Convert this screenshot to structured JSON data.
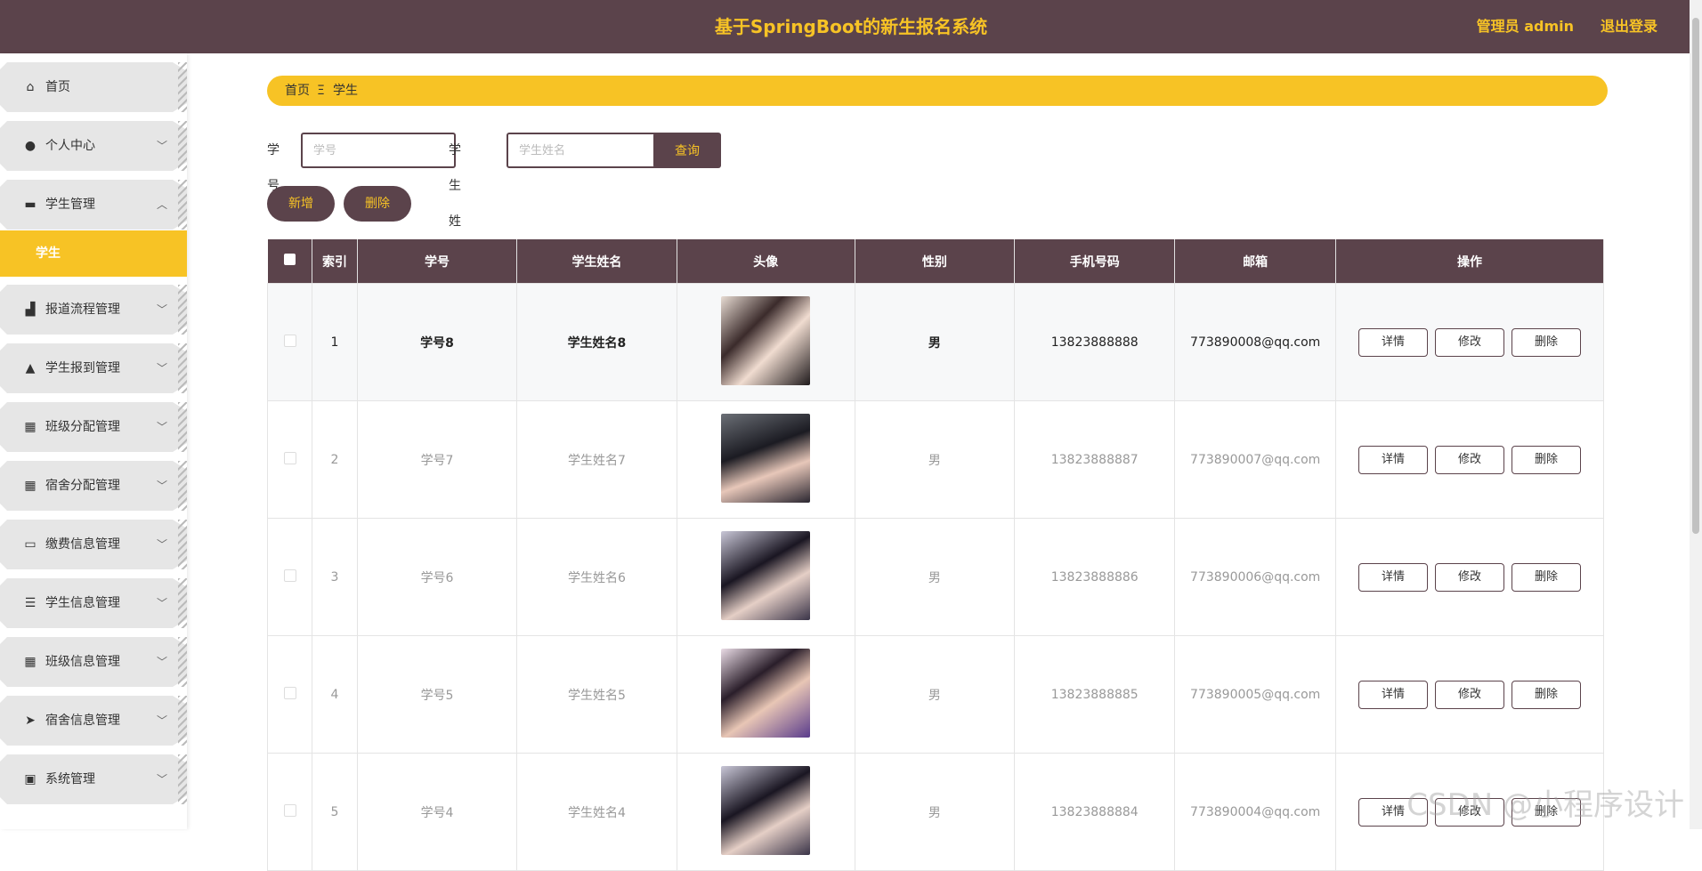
{
  "header": {
    "title": "基于SpringBoot的新生报名系统",
    "user": "管理员 admin",
    "logout": "退出登录"
  },
  "sidebar": {
    "items": [
      {
        "label": "首页",
        "icon": "home-icon",
        "glyph": "⌂",
        "chevron": ""
      },
      {
        "label": "个人中心",
        "icon": "user-icon",
        "glyph": "●",
        "chevron": "﹀"
      },
      {
        "label": "学生管理",
        "icon": "flag-icon",
        "glyph": "▬",
        "chevron": "︿"
      },
      {
        "label": "报道流程管理",
        "icon": "building-icon",
        "glyph": "▟",
        "chevron": "﹀"
      },
      {
        "label": "学生报到管理",
        "icon": "person-icon",
        "glyph": "▲",
        "chevron": "﹀"
      },
      {
        "label": "班级分配管理",
        "icon": "grid-icon",
        "glyph": "▦",
        "chevron": "﹀"
      },
      {
        "label": "宿舍分配管理",
        "icon": "grid-icon",
        "glyph": "▦",
        "chevron": "﹀"
      },
      {
        "label": "缴费信息管理",
        "icon": "monitor-icon",
        "glyph": "▭",
        "chevron": "﹀"
      },
      {
        "label": "学生信息管理",
        "icon": "list-icon",
        "glyph": "☰",
        "chevron": "﹀"
      },
      {
        "label": "班级信息管理",
        "icon": "grid-icon",
        "glyph": "▦",
        "chevron": "﹀"
      },
      {
        "label": "宿舍信息管理",
        "icon": "send-icon",
        "glyph": "➤",
        "chevron": "﹀"
      },
      {
        "label": "系统管理",
        "icon": "clipboard-icon",
        "glyph": "▣",
        "chevron": "﹀"
      }
    ],
    "sub_item": "学生"
  },
  "breadcrumb": {
    "home": "首页",
    "sep": "Ξ",
    "current": "学生"
  },
  "search": {
    "id_label": "学号",
    "id_placeholder": "学号",
    "name_label": "学生姓名",
    "name_placeholder": "学生姓名",
    "query": "查询"
  },
  "actions": {
    "add": "新增",
    "delete": "删除"
  },
  "table": {
    "headers": [
      "索引",
      "学号",
      "学生姓名",
      "头像",
      "性别",
      "手机号码",
      "邮箱",
      "操作"
    ],
    "row_actions": [
      "详情",
      "修改",
      "删除"
    ],
    "rows": [
      {
        "index": "1",
        "id": "学号8",
        "name": "学生姓名8",
        "gender": "男",
        "phone": "13823888888",
        "email": "773890008@qq.com"
      },
      {
        "index": "2",
        "id": "学号7",
        "name": "学生姓名7",
        "gender": "男",
        "phone": "13823888887",
        "email": "773890007@qq.com"
      },
      {
        "index": "3",
        "id": "学号6",
        "name": "学生姓名6",
        "gender": "男",
        "phone": "13823888886",
        "email": "773890006@qq.com"
      },
      {
        "index": "4",
        "id": "学号5",
        "name": "学生姓名5",
        "gender": "男",
        "phone": "13823888885",
        "email": "773890005@qq.com"
      },
      {
        "index": "5",
        "id": "学号4",
        "name": "学生姓名4",
        "gender": "男",
        "phone": "13823888884",
        "email": "773890004@qq.com"
      }
    ]
  },
  "colors": {
    "header_bg": "#5b434b",
    "accent": "#f7c325",
    "menu_bg": "#e6e6e6"
  },
  "watermark": "CSDN @小程序设计"
}
